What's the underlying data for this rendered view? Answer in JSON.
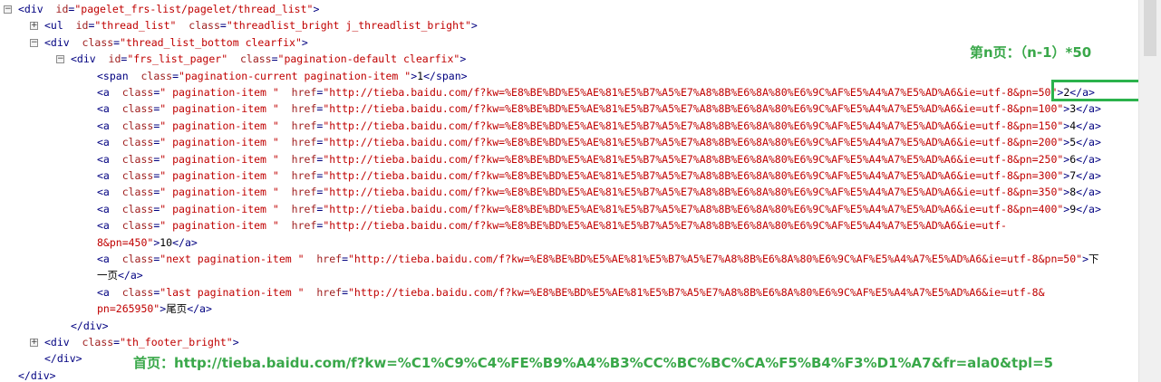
{
  "lines": [
    {
      "indent": 0,
      "toggle": "⊟",
      "tag": "div",
      "attrs": [
        {
          "name": "id",
          "value": "pagelet_frs-list/pagelet/thread_list"
        }
      ],
      "close": ">"
    },
    {
      "indent": 1,
      "toggle": "⊞",
      "tag": "ul",
      "attrs": [
        {
          "name": "id",
          "value": "thread_list"
        },
        {
          "name": "class",
          "value": "threadlist_bright j_threadlist_bright"
        }
      ],
      "close": ">"
    },
    {
      "indent": 1,
      "toggle": "⊟",
      "tag": "div",
      "attrs": [
        {
          "name": "class",
          "value": "thread_list_bottom clearfix"
        }
      ],
      "close": ">"
    },
    {
      "indent": 2,
      "toggle": "⊟",
      "tag": "div",
      "attrs": [
        {
          "name": "id",
          "value": "frs_list_pager"
        },
        {
          "name": "class",
          "value": "pagination-default clearfix"
        }
      ],
      "close": ">"
    },
    {
      "indent": 3,
      "tag": "span",
      "attrs": [
        {
          "name": "class",
          "value": "pagination-current pagination-item "
        }
      ],
      "close": ">",
      "text": "1",
      "end": "</span>"
    },
    {
      "indent": 3,
      "tag": "a",
      "attrs": [
        {
          "name": "class",
          "value": " pagination-item "
        },
        {
          "name": "href",
          "value": "http://tieba.baidu.com/f?kw=%E8%BE%BD%E5%AE%81%E5%B7%A5%E7%A8%8B%E6%8A%80%E6%9C%AF%E5%A4%A7%E5%AD%A6&ie=utf-8&pn=50"
        }
      ],
      "close": ">",
      "text": "2",
      "end": "</a>"
    },
    {
      "indent": 3,
      "tag": "a",
      "attrs": [
        {
          "name": "class",
          "value": " pagination-item "
        },
        {
          "name": "href",
          "value": "http://tieba.baidu.com/f?kw=%E8%BE%BD%E5%AE%81%E5%B7%A5%E7%A8%8B%E6%8A%80%E6%9C%AF%E5%A4%A7%E5%AD%A6&ie=utf-8&pn=100"
        }
      ],
      "close": ">",
      "text": "3",
      "end": "</a>"
    },
    {
      "indent": 3,
      "tag": "a",
      "attrs": [
        {
          "name": "class",
          "value": " pagination-item "
        },
        {
          "name": "href",
          "value": "http://tieba.baidu.com/f?kw=%E8%BE%BD%E5%AE%81%E5%B7%A5%E7%A8%8B%E6%8A%80%E6%9C%AF%E5%A4%A7%E5%AD%A6&ie=utf-8&pn=150"
        }
      ],
      "close": ">",
      "text": "4",
      "end": "</a>"
    },
    {
      "indent": 3,
      "tag": "a",
      "attrs": [
        {
          "name": "class",
          "value": " pagination-item "
        },
        {
          "name": "href",
          "value": "http://tieba.baidu.com/f?kw=%E8%BE%BD%E5%AE%81%E5%B7%A5%E7%A8%8B%E6%8A%80%E6%9C%AF%E5%A4%A7%E5%AD%A6&ie=utf-8&pn=200"
        }
      ],
      "close": ">",
      "text": "5",
      "end": "</a>"
    },
    {
      "indent": 3,
      "tag": "a",
      "attrs": [
        {
          "name": "class",
          "value": " pagination-item "
        },
        {
          "name": "href",
          "value": "http://tieba.baidu.com/f?kw=%E8%BE%BD%E5%AE%81%E5%B7%A5%E7%A8%8B%E6%8A%80%E6%9C%AF%E5%A4%A7%E5%AD%A6&ie=utf-8&pn=250"
        }
      ],
      "close": ">",
      "text": "6",
      "end": "</a>"
    },
    {
      "indent": 3,
      "tag": "a",
      "attrs": [
        {
          "name": "class",
          "value": " pagination-item "
        },
        {
          "name": "href",
          "value": "http://tieba.baidu.com/f?kw=%E8%BE%BD%E5%AE%81%E5%B7%A5%E7%A8%8B%E6%8A%80%E6%9C%AF%E5%A4%A7%E5%AD%A6&ie=utf-8&pn=300"
        }
      ],
      "close": ">",
      "text": "7",
      "end": "</a>"
    },
    {
      "indent": 3,
      "tag": "a",
      "attrs": [
        {
          "name": "class",
          "value": " pagination-item "
        },
        {
          "name": "href",
          "value": "http://tieba.baidu.com/f?kw=%E8%BE%BD%E5%AE%81%E5%B7%A5%E7%A8%8B%E6%8A%80%E6%9C%AF%E5%A4%A7%E5%AD%A6&ie=utf-8&pn=350"
        }
      ],
      "close": ">",
      "text": "8",
      "end": "</a>"
    },
    {
      "indent": 3,
      "tag": "a",
      "attrs": [
        {
          "name": "class",
          "value": " pagination-item "
        },
        {
          "name": "href",
          "value": "http://tieba.baidu.com/f?kw=%E8%BE%BD%E5%AE%81%E5%B7%A5%E7%A8%8B%E6%8A%80%E6%9C%AF%E5%A4%A7%E5%AD%A6&ie=utf-8&pn=400"
        }
      ],
      "close": ">",
      "text": "9",
      "end": "</a>"
    },
    {
      "indent": 3,
      "tag": "a",
      "attrs": [
        {
          "name": "class",
          "value": " pagination-item "
        },
        {
          "name": "href",
          "value": "http://tieba.baidu.com/f?kw=%E8%BE%BD%E5%AE%81%E5%B7%A5%E7%A8%8B%E6%8A%80%E6%9C%AF%E5%A4%A7%E5%AD%A6&ie=utf-"
        }
      ]
    },
    {
      "indent": 3,
      "cont": "8&pn=450\"",
      "close": ">",
      "text": "10",
      "end": "</a>"
    },
    {
      "indent": 3,
      "tag": "a",
      "attrs": [
        {
          "name": "class",
          "value": "next pagination-item "
        },
        {
          "name": "href",
          "value": "http://tieba.baidu.com/f?kw=%E8%BE%BD%E5%AE%81%E5%B7%A5%E7%A8%8B%E6%8A%80%E6%9C%AF%E5%A4%A7%E5%AD%A6&ie=utf-8&pn=50"
        }
      ],
      "close": ">",
      "text": "下"
    },
    {
      "indent": 3,
      "text": "一页",
      "end": "</a>"
    },
    {
      "indent": 3,
      "tag": "a",
      "attrs": [
        {
          "name": "class",
          "value": "last pagination-item "
        },
        {
          "name": "href",
          "value": "http://tieba.baidu.com/f?kw=%E8%BE%BD%E5%AE%81%E5%B7%A5%E7%A8%8B%E6%8A%80%E6%9C%AF%E5%A4%A7%E5%AD%A6&ie=utf-8&"
        }
      ]
    },
    {
      "indent": 3,
      "cont": "pn=265950\"",
      "close": ">",
      "text": "尾页",
      "end": "</a>"
    },
    {
      "indent": 2,
      "end": "</div>"
    },
    {
      "indent": 1,
      "toggle": "⊞",
      "tag": "div",
      "attrs": [
        {
          "name": "class",
          "value": "th_footer_bright"
        }
      ],
      "close": ">"
    },
    {
      "indent": 1,
      "end": "</div>"
    },
    {
      "indent": 0,
      "end": "</div>"
    }
  ],
  "annotations": {
    "page_formula": "第n页：（n-1）*50",
    "first_page": "首页：http://tieba.baidu.com/f?kw=%C1%C9%C4%FE%B9%A4%B3%CC%BC%BC%CA%F5%B4%F3%D1%A7&fr=ala0&tpl=5"
  },
  "colors": {
    "tag": "#000080",
    "attr_name": "#a02020",
    "attr_value": "#c00000",
    "text": "#000000",
    "annotation": "#3aa84a"
  }
}
